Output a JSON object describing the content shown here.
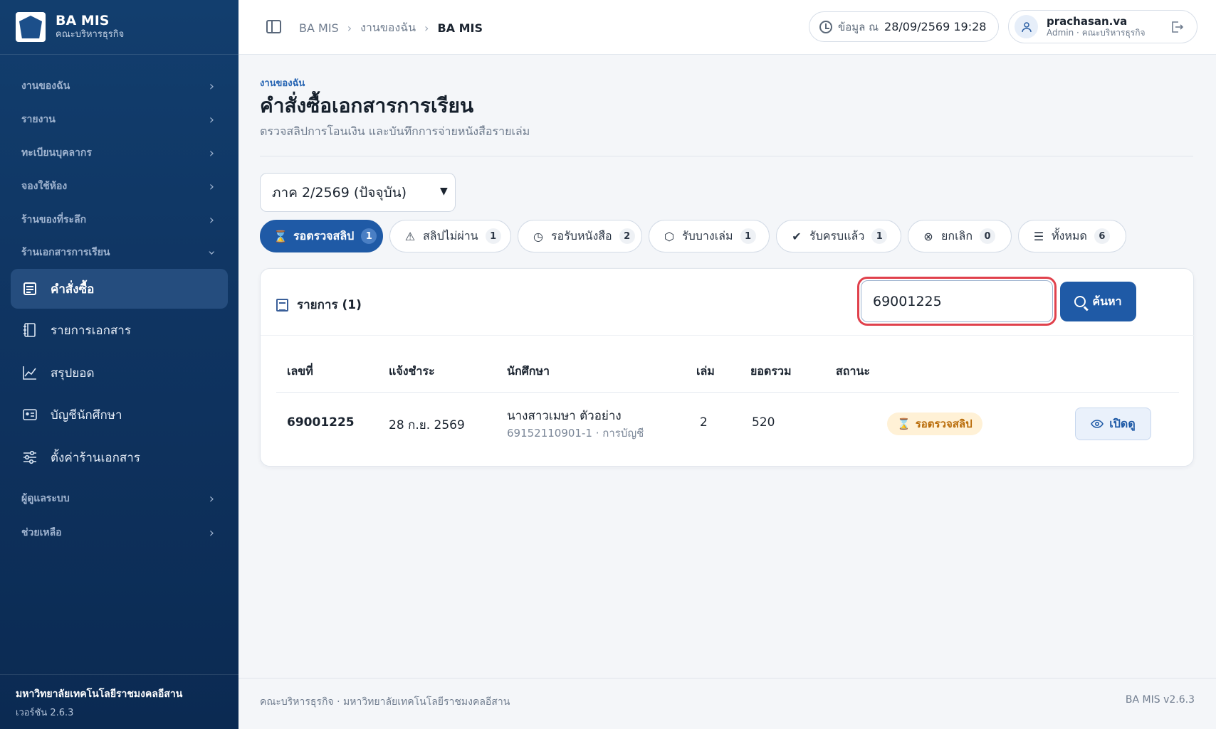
{
  "app": {
    "name": "BA MIS",
    "subtitle": "คณะบริหารธุรกิจ"
  },
  "sidebar": {
    "groups": [
      {
        "label": "งานของฉัน"
      },
      {
        "label": "รายงาน"
      },
      {
        "label": "ทะเบียนบุคลากร"
      },
      {
        "label": "จองใช้ห้อง"
      },
      {
        "label": "ร้านของที่ระลึก"
      },
      {
        "label": "ร้านเอกสารการเรียน"
      }
    ],
    "items": [
      {
        "label": "คำสั่งซื้อ",
        "icon": "orders-icon"
      },
      {
        "label": "รายการเอกสาร",
        "icon": "book-icon"
      },
      {
        "label": "สรุปยอด",
        "icon": "chart-line-icon"
      },
      {
        "label": "บัญชีนักศึกษา",
        "icon": "id-card-icon"
      },
      {
        "label": "ตั้งค่าร้านเอกสาร",
        "icon": "sliders-icon"
      }
    ],
    "groups_bottom": [
      {
        "label": "ผู้ดูแลระบบ"
      },
      {
        "label": "ช่วยเหลือ"
      }
    ],
    "footer": {
      "university": "มหาวิทยาลัยเทคโนโลยีราชมงคลอีสาน",
      "version": "เวอร์ชัน 2.6.3"
    }
  },
  "topbar": {
    "breadcrumb": [
      "BA MIS",
      "งานของฉัน",
      "BA MIS"
    ],
    "data_label": "ข้อมูล ณ",
    "data_time": "28/09/2569 19:28",
    "user_name": "prachasan.va",
    "user_role": "Admin · คณะบริหารธุรกิจ"
  },
  "page": {
    "eyebrow": "งานของฉัน",
    "title": "คำสั่งซื้อเอกสารการเรียน",
    "subtitle": "ตรวจสลิปการโอนเงิน และบันทึกการจ่ายหนังสือรายเล่ม",
    "term_selected": "ภาค 2/2569 (ปัจจุบัน)"
  },
  "tabs": [
    {
      "label": "รอตรวจสลิป",
      "count": "1",
      "icon": "hourglass-icon",
      "active": true
    },
    {
      "label": "สลิปไม่ผ่าน",
      "count": "1",
      "icon": "warning-icon"
    },
    {
      "label": "รอรับหนังสือ",
      "count": "2",
      "icon": "clock-icon"
    },
    {
      "label": "รับบางเล่ม",
      "count": "1",
      "icon": "box-icon"
    },
    {
      "label": "รับครบแล้ว",
      "count": "1",
      "icon": "check-circle-icon"
    },
    {
      "label": "ยกเลิก",
      "count": "0",
      "icon": "x-circle-icon"
    },
    {
      "label": "ทั้งหมด",
      "count": "6",
      "icon": "list-icon"
    }
  ],
  "list": {
    "title": "รายการ (1)",
    "search_value": "69001225",
    "search_button": "ค้นหา",
    "columns": [
      "เลขที่",
      "แจ้งชำระ",
      "นักศึกษา",
      "เล่ม",
      "ยอดรวม",
      "สถานะ"
    ],
    "rows": [
      {
        "number": "69001225",
        "date": "28 ก.ย. 2569",
        "student_name": "นางสาวเมษา ตัวอย่าง",
        "student_meta": "69152110901-1 · การบัญชี",
        "books": "2",
        "total": "520",
        "status": "รอตรวจสลิป",
        "action": "เปิดดู"
      }
    ]
  },
  "footer": {
    "left": "คณะบริหารธุรกิจ · มหาวิทยาลัยเทคโนโลยีราชมงคลอีสาน",
    "right": "BA MIS v2.6.3"
  },
  "colors": {
    "sidebar": "#0f3461",
    "primary": "#1f5aa6",
    "highlight_ring": "#e0414c",
    "status_pending_bg": "#fff1d6",
    "status_pending_text": "#b86a06"
  }
}
